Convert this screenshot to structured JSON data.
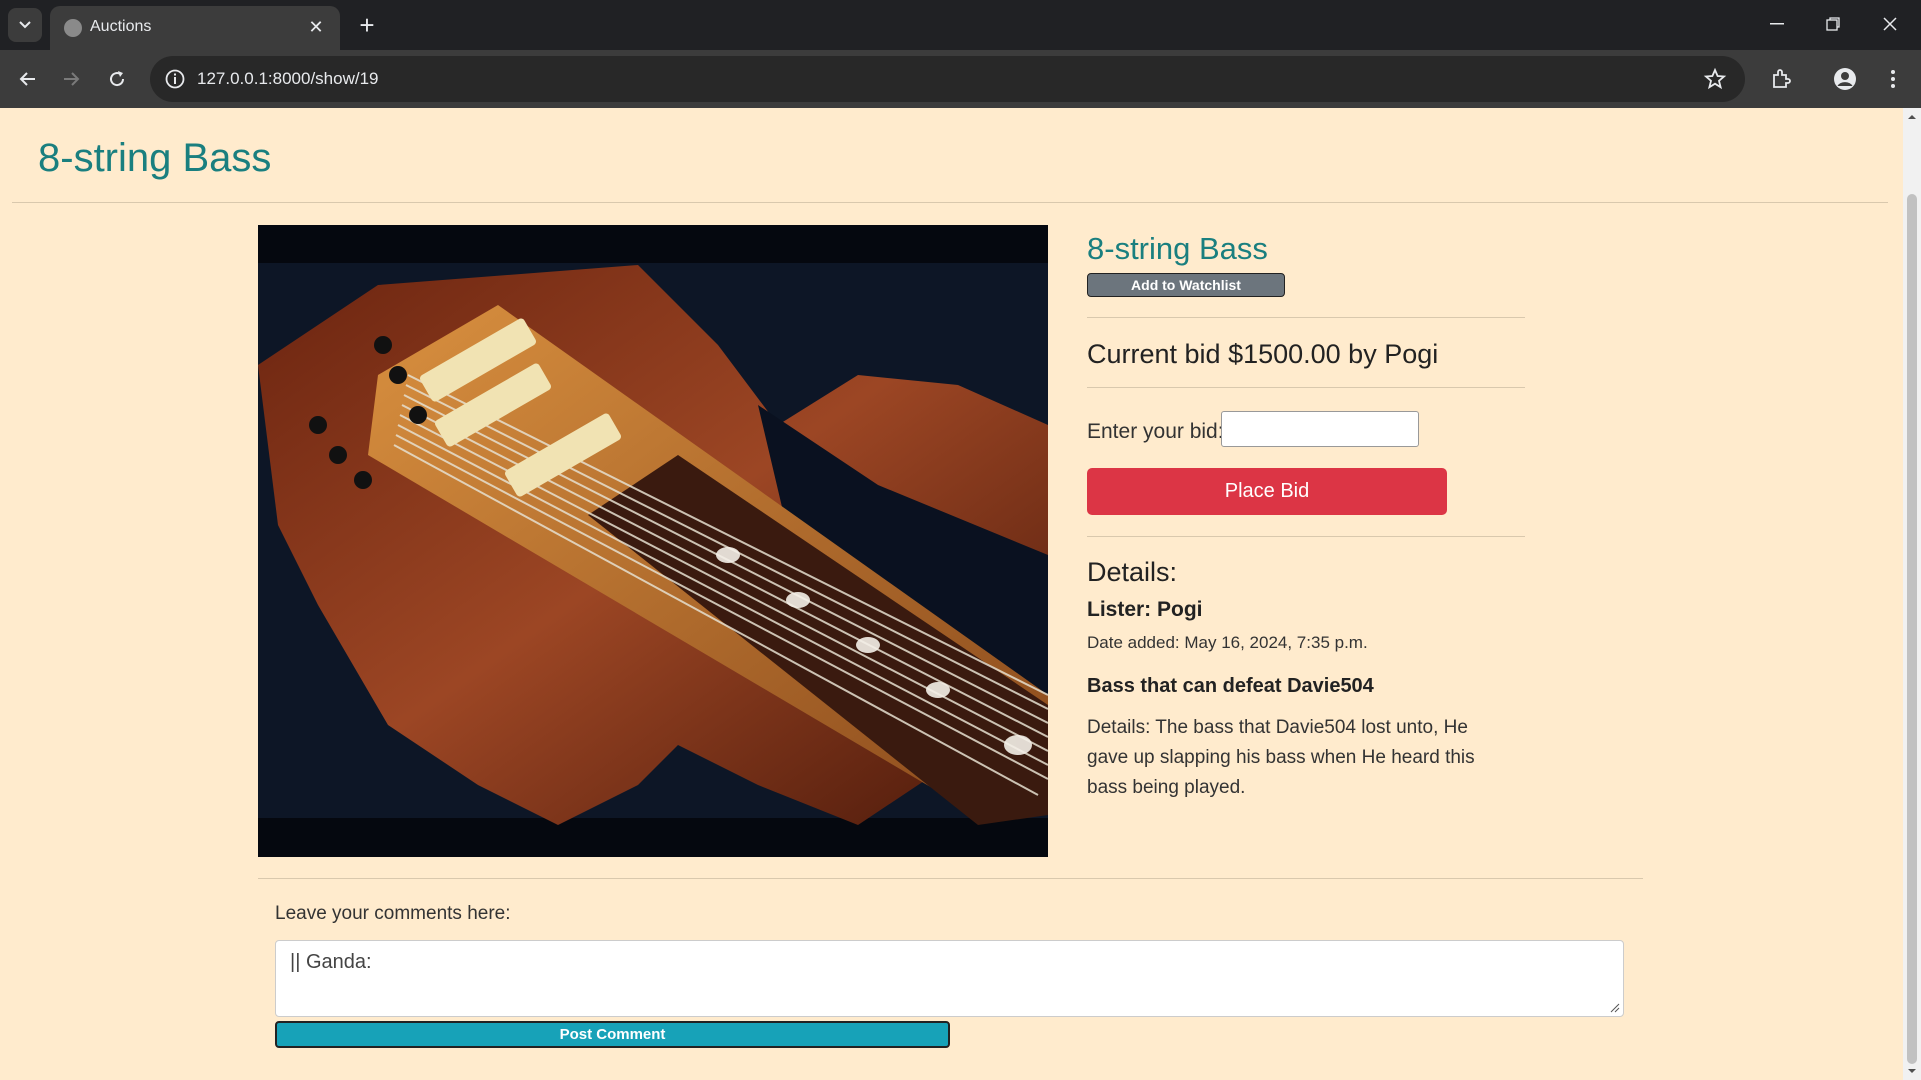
{
  "browser": {
    "tab_title": "Auctions",
    "url": "127.0.0.1:8000/show/19",
    "icons": [
      "tab-search-icon",
      "globe-icon",
      "close-icon",
      "plus-icon",
      "minimize-icon",
      "restore-icon",
      "close-window-icon",
      "back-icon",
      "forward-icon",
      "reload-icon",
      "info-icon",
      "star-icon",
      "extensions-icon",
      "profile-icon",
      "menu-icon"
    ]
  },
  "page": {
    "heading": "8-string Bass"
  },
  "listing": {
    "title": "8-string Bass",
    "watchlist_label": "Add to Watchlist",
    "current_bid_text": "Current bid $1500.00 by Pogi",
    "bid_label": "Enter your bid:",
    "bid_value": "",
    "place_bid_label": "Place Bid",
    "details_heading": "Details:",
    "lister_text": "Lister: Pogi",
    "date_added_text": "Date added: May 16, 2024, 7:35 p.m.",
    "subtitle": "Bass that can defeat Davie504",
    "description": "Details: The bass that Davie504 lost unto, He gave up slapping his bass when He heard this bass being played."
  },
  "comments": {
    "label": "Leave your comments here:",
    "draft": "|| Ganda:",
    "post_label": "Post Comment"
  },
  "colors": {
    "page_bg": "#ffebcd",
    "title": "#1a7f7f",
    "danger": "#dc3545",
    "info": "#17a2b8",
    "secondary": "#6c757d"
  }
}
